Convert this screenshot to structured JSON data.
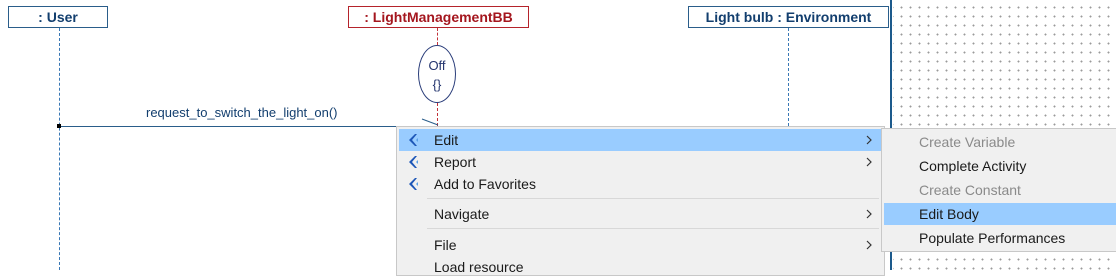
{
  "diagram": {
    "lifelines": [
      {
        "label": ": User"
      },
      {
        "label": ": LightManagementBB"
      },
      {
        "label": "Light bulb : Environment"
      }
    ],
    "state": {
      "name": "Off",
      "body": "{}"
    },
    "message": "request_to_switch_the_light_on()"
  },
  "context_menu": {
    "items": [
      {
        "label": "Edit",
        "icon": "capella-icon",
        "submenu": true,
        "highlighted": true
      },
      {
        "label": "Report",
        "icon": "capella-icon",
        "submenu": true
      },
      {
        "label": "Add to Favorites",
        "icon": "capella-icon",
        "submenu": false
      },
      {
        "label": "Navigate",
        "submenu": true
      },
      {
        "label": "File",
        "submenu": true
      },
      {
        "label": "Load resource",
        "submenu": false
      }
    ]
  },
  "submenu": {
    "items": [
      {
        "label": "Create Variable",
        "enabled": false
      },
      {
        "label": "Complete Activity",
        "enabled": true
      },
      {
        "label": "Create Constant",
        "enabled": false
      },
      {
        "label": "Edit Body",
        "enabled": true,
        "highlighted": true
      },
      {
        "label": "Populate Performances",
        "enabled": true
      }
    ]
  },
  "colors": {
    "menu_highlight": "#99ccff",
    "lifeline_blue": "#2a5d8a",
    "lifeline_red": "#b5232b"
  }
}
